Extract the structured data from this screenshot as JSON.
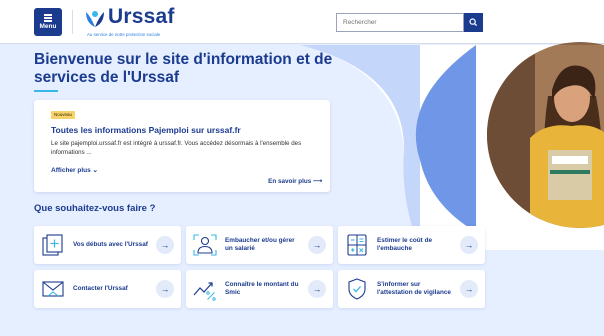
{
  "header": {
    "menu_label": "Menu",
    "logo_name": "Urssaf",
    "logo_tagline": "Au service de notre protection sociale",
    "search_placeholder": "Rechercher"
  },
  "hero": {
    "title": "Bienvenue sur le site d'information et de services de l'Urssaf"
  },
  "news": {
    "badge": "Nouveau",
    "title": "Toutes les informations Pajemploi sur urssaf.fr",
    "text": "Le site pajemploi.urssaf.fr est intégré à urssaf.fr. Vous accédez désormais à l'ensemble des informations ...",
    "show_more": "Afficher plus ⌄",
    "learn_more": "En savoir plus ⟶"
  },
  "question": "Que souhaitez-vous faire ?",
  "actions": [
    {
      "label": "Vos débuts avec l'Urssaf",
      "icon": "add-document-icon"
    },
    {
      "label": "Embaucher et/ou gérer un salarié",
      "icon": "employee-icon"
    },
    {
      "label": "Estimer le coût de l'embauche",
      "icon": "calculator-icon"
    },
    {
      "label": "Contacter l'Urssaf",
      "icon": "mail-icon"
    },
    {
      "label": "Connaître le montant du Smic",
      "icon": "trend-percent-icon"
    },
    {
      "label": "S'informer sur l'attestation de vigilance",
      "icon": "shield-check-icon"
    }
  ],
  "arrow_glyph": "→",
  "colors": {
    "primary": "#1b3b8f",
    "accent": "#39b7e8",
    "background": "#e6efff",
    "badge": "#f7d36a"
  }
}
